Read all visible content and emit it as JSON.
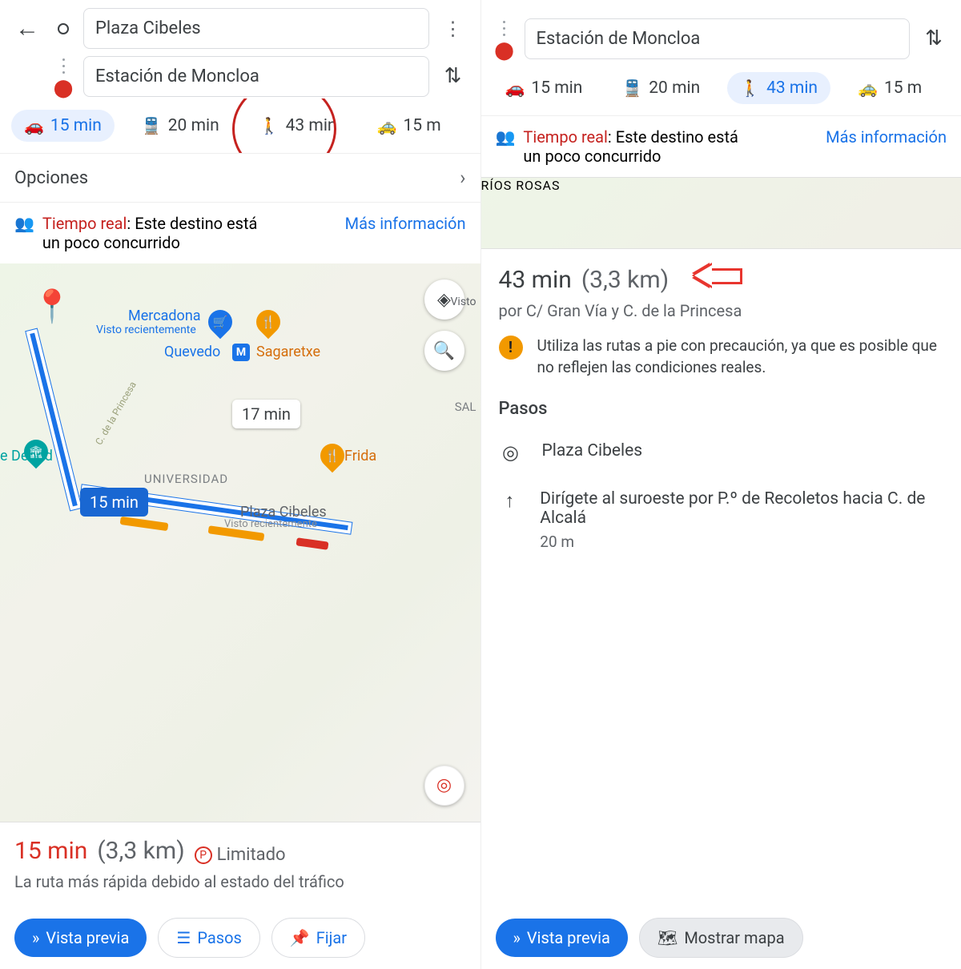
{
  "left": {
    "origin": "Plaza Cibeles",
    "destination": "Estación de Moncloa",
    "modes": {
      "car": {
        "time": "15 min",
        "selected": true
      },
      "train": {
        "time": "20 min"
      },
      "walk": {
        "time": "43 min",
        "circled": true
      },
      "hail": {
        "time": "15 m"
      }
    },
    "options_label": "Opciones",
    "realtime": {
      "label": "Tiempo real",
      "text": ": Este destino está un poco concurrido",
      "link": "Más información"
    },
    "map": {
      "badge_main": "15 min",
      "badge_alt": "17 min",
      "labels": {
        "mercadona": "Mercadona",
        "visto": "Visto recientemente",
        "quevedo": "Quevedo",
        "sagaretxe": "Sagaretxe",
        "frida": "Frida",
        "debod": "e Debod",
        "universidad": "UNIVERSIDAD",
        "cibeles": "Plaza Cibeles",
        "sal": "SAL",
        "visto2": "Visto",
        "visto3": "Visto recientemente",
        "princesa": "C. de la Princesa"
      }
    },
    "summary": {
      "time": "15 min",
      "dist": "(3,3 km)",
      "parking": "Limitado",
      "note": "La ruta más rápida debido al estado del tráfico"
    },
    "actions": {
      "preview": "Vista previa",
      "steps": "Pasos",
      "pin": "Fijar"
    }
  },
  "right": {
    "destination": "Estación de Moncloa",
    "modes": {
      "car": {
        "time": "15 min"
      },
      "train": {
        "time": "20 min"
      },
      "walk": {
        "time": "43 min",
        "selected": true
      },
      "hail": {
        "time": "15 m"
      }
    },
    "realtime": {
      "label": "Tiempo real",
      "text": ": Este destino está un poco concurrido",
      "link": "Más información"
    },
    "map_strip": {
      "rios_rosas": "RÍOS ROSAS"
    },
    "summary": {
      "time": "43 min",
      "dist": "(3,3 km)",
      "via": "por C/ Gran Vía y C. de la Princesa"
    },
    "warning": "Utiliza las rutas a pie con precaución, ya que es posible que no reflejen las condiciones reales.",
    "steps_head": "Pasos",
    "steps": [
      {
        "icon": "pin",
        "text": "Plaza Cibeles"
      },
      {
        "icon": "up",
        "text": "Dirígete al suroeste por P.º de Recoletos hacia C. de Alcalá",
        "dist": "20 m"
      }
    ],
    "actions": {
      "preview": "Vista previa",
      "showmap": "Mostrar mapa"
    }
  }
}
